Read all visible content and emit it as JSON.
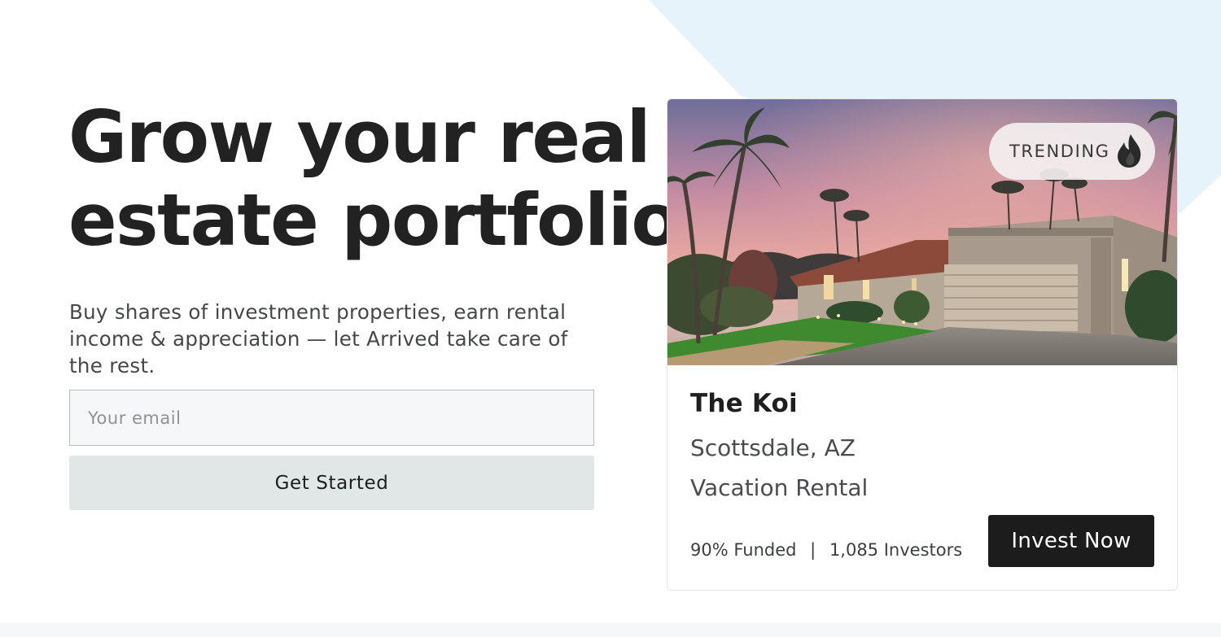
{
  "hero": {
    "title_line1": "Grow your real",
    "title_line2": "estate portfolio",
    "subtitle": "Buy shares of investment properties, earn rental income & appreciation — let Arrived take care of the rest."
  },
  "signup": {
    "email_placeholder": "Your email",
    "email_value": "",
    "button_label": "Get Started"
  },
  "property_card": {
    "badge_label": "TRENDING",
    "badge_icon": "flame-icon",
    "name": "The Koi",
    "location": "Scottsdale, AZ",
    "type": "Vacation Rental",
    "funded": "90% Funded",
    "separator": "|",
    "investors": "1,085 Investors",
    "funded_fraction": 0.9,
    "button_label": "Invest Now"
  },
  "colors": {
    "accent_bg": "#e6f3fb",
    "cta_button": "#e1e6e7",
    "invest_button": "#1c1c1c",
    "text_dark": "#222222"
  }
}
